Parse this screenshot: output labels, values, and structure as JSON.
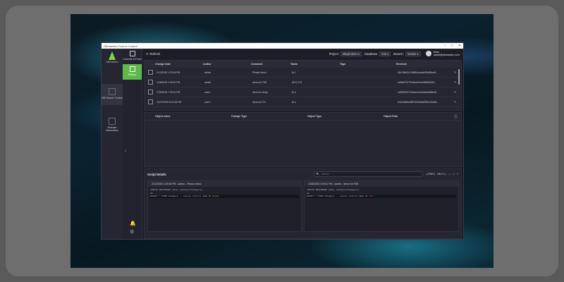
{
  "window": {
    "title": "DBmaestro Source Control"
  },
  "sidebar": {
    "logo_text": "DBmaestro",
    "items": [
      {
        "label": "DB Source Control",
        "icon": "database-icon"
      },
      {
        "label": "Release Automation",
        "icon": "flow-icon"
      }
    ]
  },
  "subnav": {
    "items": [
      {
        "label": "Commit & Push",
        "icon": "commit-icon"
      },
      {
        "label": "History",
        "icon": "history-icon"
      }
    ],
    "active": "History"
  },
  "topbar": {
    "refresh_label": "Refresh",
    "project_label": "Project:",
    "project_value": "MsqlAdvert",
    "database_label": "Database:",
    "database_value": "test",
    "branch_label": "Branch:",
    "branch_value": "master",
    "hello": "Hello,",
    "user": "admin@dbmaestro.com"
  },
  "history": {
    "columns": [
      "Change Date",
      "Author",
      "Comment",
      "Tasks",
      "Tags",
      "Revision"
    ],
    "rows": [
      {
        "date": "2/12/2026 1:29:06 PM",
        "author": "admin",
        "comment": "Please demo",
        "tasks": "tk-1",
        "tags": "",
        "revision": "f5e7d5b52c7b5f8b4ccaeb9fc68ba4f..."
      },
      {
        "date": "12/8/2025 2:49:51 PM",
        "author": "admin",
        "comment": "demo for F58",
        "tasks": "ADO-176",
        "tags": "",
        "revision": "dcf5d578737b4ba4f1ced6f8b5fc93..."
      },
      {
        "date": "7/28/2025 7:29:01 PM",
        "author": "user1",
        "comment": "demo for Andy",
        "tasks": "tk-3",
        "tags": "",
        "revision": "0a5f0929076f4dcac3cbfa6a6e88fc6f..."
      },
      {
        "date": "10/27/2025 8:41:06 PM",
        "author": "user1",
        "comment": "demo for FD",
        "tasks": "tk-4",
        "tags": "",
        "revision": "b4c23a8bed8091b0ba6ef59bcc9c8f1..."
      }
    ]
  },
  "objects": {
    "columns": [
      "Object name",
      "Change Type",
      "Object Type",
      "Object Path"
    ]
  },
  "script": {
    "title": "Script Details",
    "search_placeholder": "Search",
    "prev": "PREV",
    "next": "NEXT",
    "left": {
      "header": "2/12/2026 1:29:06 PM - admin - Please demo",
      "lines": [
        "CREATE PROCEDURE [dbo].[ehSelectCategory]",
        "AS",
        "SELECT * FROM Category -- source control demo 01"
      ],
      "highlight": "Ready"
    },
    "right": {
      "header": "12/8/2025 2:49:51 PM - admin - demo for F58",
      "lines": [
        "CREATE PROCEDURE [dbo].[ehSelectCategory]",
        "AS",
        "SELECT * FROM Category -- source control demo 01"
      ],
      "highlight": "F58"
    }
  }
}
